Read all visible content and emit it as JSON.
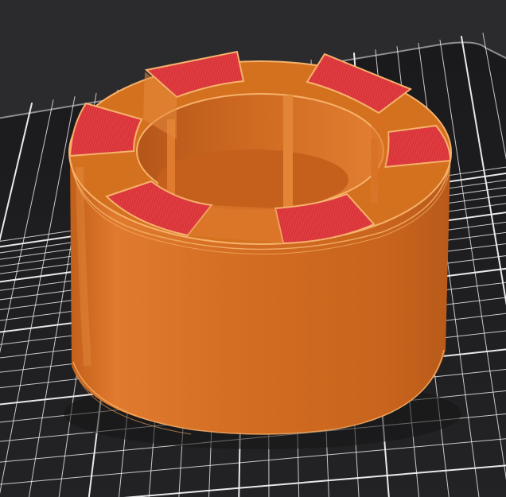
{
  "viewport": {
    "title": ""
  },
  "scene": {
    "icon": "3d-print-preview",
    "colors": {
      "background": "#2b2b2d",
      "bed": "#1c1c1e",
      "bed_edge": "#8e8e92",
      "grid_line": "#f4f4f6",
      "part_body": "#cf6a1e",
      "part_highlight": "#e48a3a",
      "part_shadow": "#a4521a",
      "top_infill": "#d8353b",
      "top_infill_stripe": "#ef4b50",
      "perimeter_line": "#f6b26b"
    },
    "top_segments_count": 6
  }
}
